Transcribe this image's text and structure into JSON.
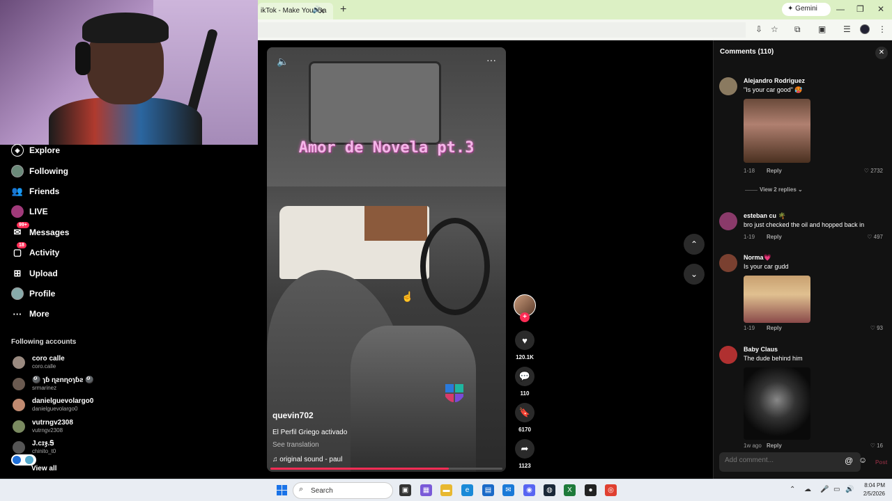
{
  "browser": {
    "tab_title": "ikTok - Make Your Da",
    "new_tab": "+",
    "gemini_label": "Gemini",
    "min": "—",
    "restore": "❐",
    "close": "✕"
  },
  "sidebar": {
    "items": [
      {
        "label": "Explore",
        "icon": "compass-icon"
      },
      {
        "label": "Following",
        "icon": "following-avatar-icon"
      },
      {
        "label": "Friends",
        "icon": "friends-icon"
      },
      {
        "label": "LIVE",
        "icon": "live-icon"
      },
      {
        "label": "Messages",
        "icon": "messages-icon",
        "badge": "99+"
      },
      {
        "label": "Activity",
        "icon": "activity-icon",
        "badge": "18"
      },
      {
        "label": "Upload",
        "icon": "upload-icon"
      },
      {
        "label": "Profile",
        "icon": "profile-icon"
      },
      {
        "label": "More",
        "icon": "more-icon"
      }
    ],
    "following_title": "Following accounts",
    "accounts": [
      {
        "name": "coro calle",
        "handle": "coro.calle"
      },
      {
        "name": "🎱 ɿɓ ɳƨnɳoɿɓƨ 🎱",
        "handle": "srmarinez"
      },
      {
        "name": "danielguevolargo0",
        "handle": "danielguevolargo0"
      },
      {
        "name": "vutrngv2308",
        "handle": "vutrngv2308"
      },
      {
        "name": "J.cɪჯ.Ꭶ",
        "handle": "chinito_t0"
      }
    ],
    "view_all": "View all"
  },
  "video": {
    "overlay_title": "Amor de Novela pt.3",
    "username": "quevin702",
    "description": "El Perfil Griego activado",
    "see_translation": "See translation",
    "music": "original sound - paul",
    "progress": 0.77
  },
  "actions": {
    "likes": "120.1K",
    "comments": "110",
    "saves": "6170",
    "shares": "1123"
  },
  "comments": {
    "header": "Comments",
    "count": "(110)",
    "items": [
      {
        "name": "Alejandro Rodriguez",
        "text": "\"Is your car good\" 🥵",
        "date": "1-18",
        "reply": "Reply",
        "likes": "2732",
        "view_replies": "View 2 replies"
      },
      {
        "name": "esteban cu 🌴",
        "text": "bro just checked the oil and hopped back in",
        "date": "1-19",
        "reply": "Reply",
        "likes": "497"
      },
      {
        "name": "Norma💗",
        "text": "Is your car gudd",
        "date": "1-19",
        "reply": "Reply",
        "likes": "93"
      },
      {
        "name": "Baby Claus",
        "text": "The dude behind him",
        "date": "1w ago",
        "reply": "Reply",
        "likes": "16"
      }
    ],
    "input_placeholder": "Add comment...",
    "post": "Post"
  },
  "taskbar": {
    "search": "Search",
    "time": "8:04 PM",
    "date": "2/5/2026"
  }
}
